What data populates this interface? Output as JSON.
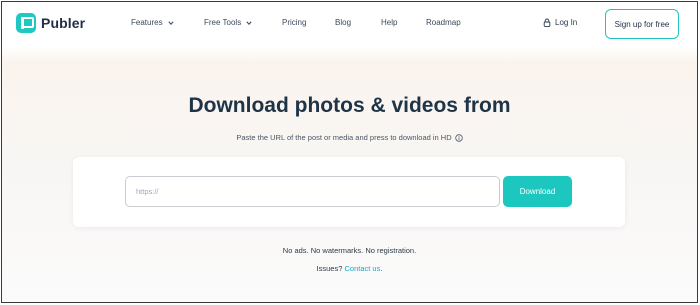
{
  "brand": {
    "name": "Publer",
    "accent": "#1fc8c1"
  },
  "nav": {
    "items": [
      {
        "label": "Features",
        "dropdown": true
      },
      {
        "label": "Free Tools",
        "dropdown": true
      },
      {
        "label": "Pricing",
        "dropdown": false
      },
      {
        "label": "Blog",
        "dropdown": false
      },
      {
        "label": "Help",
        "dropdown": false
      },
      {
        "label": "Roadmap",
        "dropdown": false
      }
    ],
    "login_label": "Log In",
    "signup_label": "Sign up for free"
  },
  "hero": {
    "title": "Download photos & videos from",
    "subtitle": "Paste the URL of the post or media and press to download in HD"
  },
  "form": {
    "url_placeholder": "https://",
    "url_value": "",
    "download_label": "Download"
  },
  "footer_note": {
    "tagline": "No ads. No watermarks. No registration.",
    "issues_prefix": "Issues?",
    "contact_label": "Contact us",
    "issues_suffix": "."
  }
}
